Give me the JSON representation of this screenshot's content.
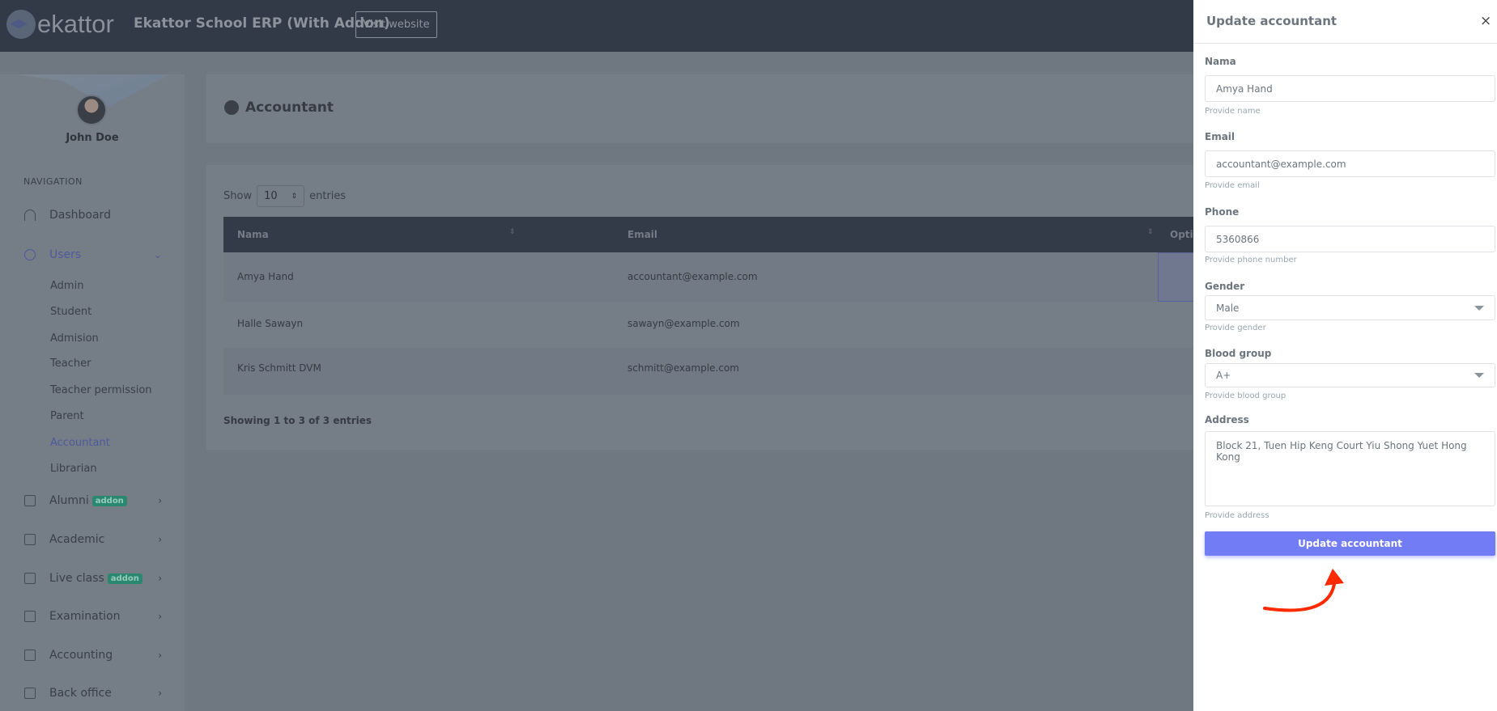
{
  "header": {
    "logo": "ekattor",
    "title": "Ekattor School ERP (With Addon)",
    "visit_label": "Visit website"
  },
  "sidebar": {
    "user": "John Doe",
    "nav_heading": "NAVIGATION",
    "items": [
      {
        "label": "Dashboard"
      },
      {
        "label": "Users"
      },
      {
        "label": "Alumni",
        "badge": "addon"
      },
      {
        "label": "Academic"
      },
      {
        "label": "Live class",
        "badge": "addon"
      },
      {
        "label": "Examination"
      },
      {
        "label": "Accounting"
      },
      {
        "label": "Back office"
      }
    ],
    "users_sub": [
      "Admin",
      "Student",
      "Admision",
      "Teacher",
      "Teacher permission",
      "Parent",
      "Accountant",
      "Librarian"
    ],
    "active": "Accountant",
    "active_color": "#4f5a9a"
  },
  "main": {
    "title": "Accountant",
    "show": "Show",
    "entries_value": "10",
    "entries": "entries",
    "columns": [
      "Nama",
      "Email",
      "Optic"
    ],
    "rows": [
      {
        "name": "Amya Hand",
        "email": "accountant@example.com"
      },
      {
        "name": "Halle Sawayn",
        "email": "sawayn@example.com"
      },
      {
        "name": "Kris Schmitt DVM",
        "email": "schmitt@example.com"
      }
    ],
    "showing": "Showing 1 to 3 of 3 entries"
  },
  "panel": {
    "title": "Update accountant",
    "close": "×",
    "fields": {
      "name": {
        "label": "Nama",
        "value": "Amya Hand",
        "help": "Provide name"
      },
      "email": {
        "label": "Email",
        "value": "accountant@example.com",
        "help": "Provide email"
      },
      "phone": {
        "label": "Phone",
        "value": "5360866",
        "help": "Provide phone number"
      },
      "gender": {
        "label": "Gender",
        "value": "Male",
        "help": "Provide gender"
      },
      "blood": {
        "label": "Blood group",
        "value": "A+",
        "help": "Provide blood group"
      },
      "address": {
        "label": "Address",
        "value": "Block 21, Tuen Hip Keng Court Yiu Shong Yuet Hong Kong",
        "help": "Provide address"
      }
    },
    "submit": "Update accountant",
    "accent": "#727cf5",
    "arrow_color": "#ff2a00"
  }
}
